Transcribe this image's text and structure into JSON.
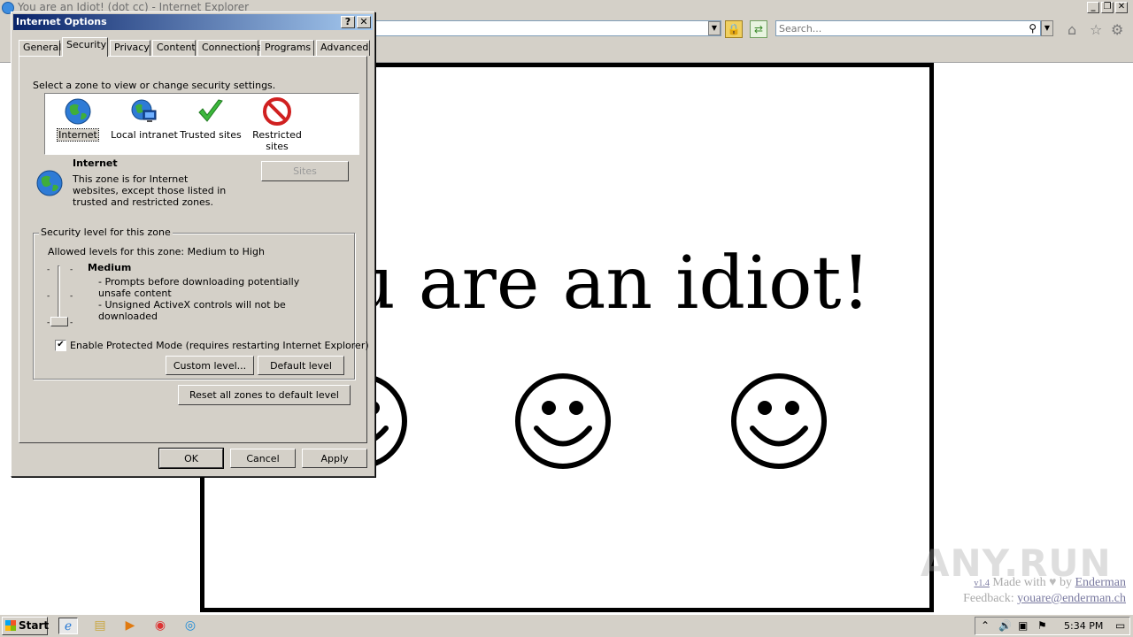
{
  "browser": {
    "title": "You are an Idiot! (dot cc) - Internet Explorer",
    "address": "",
    "search_placeholder": "Search..."
  },
  "page": {
    "headline": "You are an idiot!",
    "smiley_count": 3,
    "footer": {
      "version": "v1.4",
      "made_with": "Made with",
      "by": "by",
      "author": "Enderman",
      "feedback_label": "Feedback:",
      "email": "youare@enderman.ch"
    },
    "watermark": "ANY.RUN"
  },
  "dialog": {
    "title": "Internet Options",
    "help_btn": "?",
    "close_btn": "✕",
    "tabs": [
      {
        "label": "General"
      },
      {
        "label": "Security"
      },
      {
        "label": "Privacy"
      },
      {
        "label": "Content"
      },
      {
        "label": "Connections"
      },
      {
        "label": "Programs"
      },
      {
        "label": "Advanced"
      }
    ],
    "active_tab": "Security",
    "select_zone_label": "Select a zone to view or change security settings.",
    "zones": [
      {
        "label": "Internet",
        "icon": "globe-icon",
        "selected": true
      },
      {
        "label": "Local intranet",
        "icon": "intranet-icon",
        "selected": false
      },
      {
        "label": "Trusted sites",
        "icon": "checkmark-icon",
        "selected": false
      },
      {
        "label": "Restricted sites",
        "icon": "restricted-icon",
        "selected": false
      }
    ],
    "zone_info": {
      "name": "Internet",
      "description": "This zone is for Internet websites, except those listed in trusted and restricted zones."
    },
    "sites_button": "Sites",
    "security_level": {
      "group_title": "Security level for this zone",
      "allowed": "Allowed levels for this zone: Medium to High",
      "level_name": "Medium",
      "details": [
        "- Prompts before downloading potentially unsafe content",
        "- Unsigned ActiveX controls will not be downloaded"
      ],
      "protected_mode_label": "Enable Protected Mode (requires restarting Internet Explorer)",
      "protected_mode_checked": true,
      "custom_level_button": "Custom level...",
      "default_level_button": "Default level"
    },
    "reset_button": "Reset all zones to default level",
    "ok_button": "OK",
    "cancel_button": "Cancel",
    "apply_button": "Apply"
  },
  "taskbar": {
    "start_label": "Start",
    "clock": "5:34 PM",
    "apps": [
      "internet-explorer-icon",
      "file-explorer-icon",
      "media-player-icon",
      "chrome-icon",
      "edge-icon"
    ]
  },
  "colors": {
    "dialog_bg": "#d4d0c8",
    "titlebar_start": "#0a246a",
    "titlebar_end": "#a6caf0"
  }
}
